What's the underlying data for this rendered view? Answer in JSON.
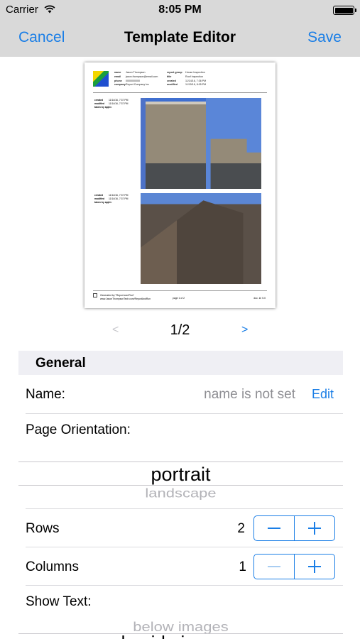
{
  "status_bar": {
    "carrier": "Carrier",
    "time": "8:05 PM"
  },
  "nav": {
    "cancel_label": "Cancel",
    "title": "Template Editor",
    "save_label": "Save"
  },
  "preview": {
    "header_left": [
      {
        "key": "name",
        "value": "Jason Thompson"
      },
      {
        "key": "email",
        "value": "jason.thompson@email.com"
      },
      {
        "key": "phone",
        "value": "0000000000"
      },
      {
        "key": "company",
        "value": "Report Company Inc"
      }
    ],
    "header_right": [
      {
        "key": "report group",
        "value": "House Inspection"
      },
      {
        "key": "title",
        "value": "Roof Inspection"
      },
      {
        "key": "created",
        "value": "11/14/16, 7:36 PM"
      },
      {
        "key": "modified",
        "value": "11/15/16, 8:05 PM"
      }
    ],
    "photo_meta": [
      [
        {
          "key": "created",
          "value": "11/14/16, 7:37 PM"
        },
        {
          "key": "modified",
          "value": "11/14/16, 7:37 PM"
        },
        {
          "key": "taken by app",
          "value": "No"
        }
      ],
      [
        {
          "key": "created",
          "value": "11/14/16, 7:37 PM"
        },
        {
          "key": "modified",
          "value": "11/14/16, 7:37 PM"
        },
        {
          "key": "taken by app",
          "value": "No"
        }
      ]
    ],
    "footer_line1": "Generated by \"Report and Run\"",
    "footer_line2": "www.JasonThompsonTech.com/ReportAndRun",
    "footer_page": "page 1 of 2",
    "footer_doc": "doc. id: 5.0"
  },
  "pager": {
    "prev": "<",
    "page": "1/2",
    "next": ">"
  },
  "section": {
    "title": "General"
  },
  "name_row": {
    "label": "Name:",
    "value": "name is not set",
    "edit_label": "Edit"
  },
  "orientation": {
    "label": "Page Orientation:",
    "selected": "portrait",
    "next_option": "landscape"
  },
  "rows_row": {
    "label": "Rows",
    "value": "2"
  },
  "columns_row": {
    "label": "Columns",
    "value": "1"
  },
  "show_text": {
    "label": "Show Text:",
    "option_above": "below images",
    "option_below": "beside images"
  }
}
